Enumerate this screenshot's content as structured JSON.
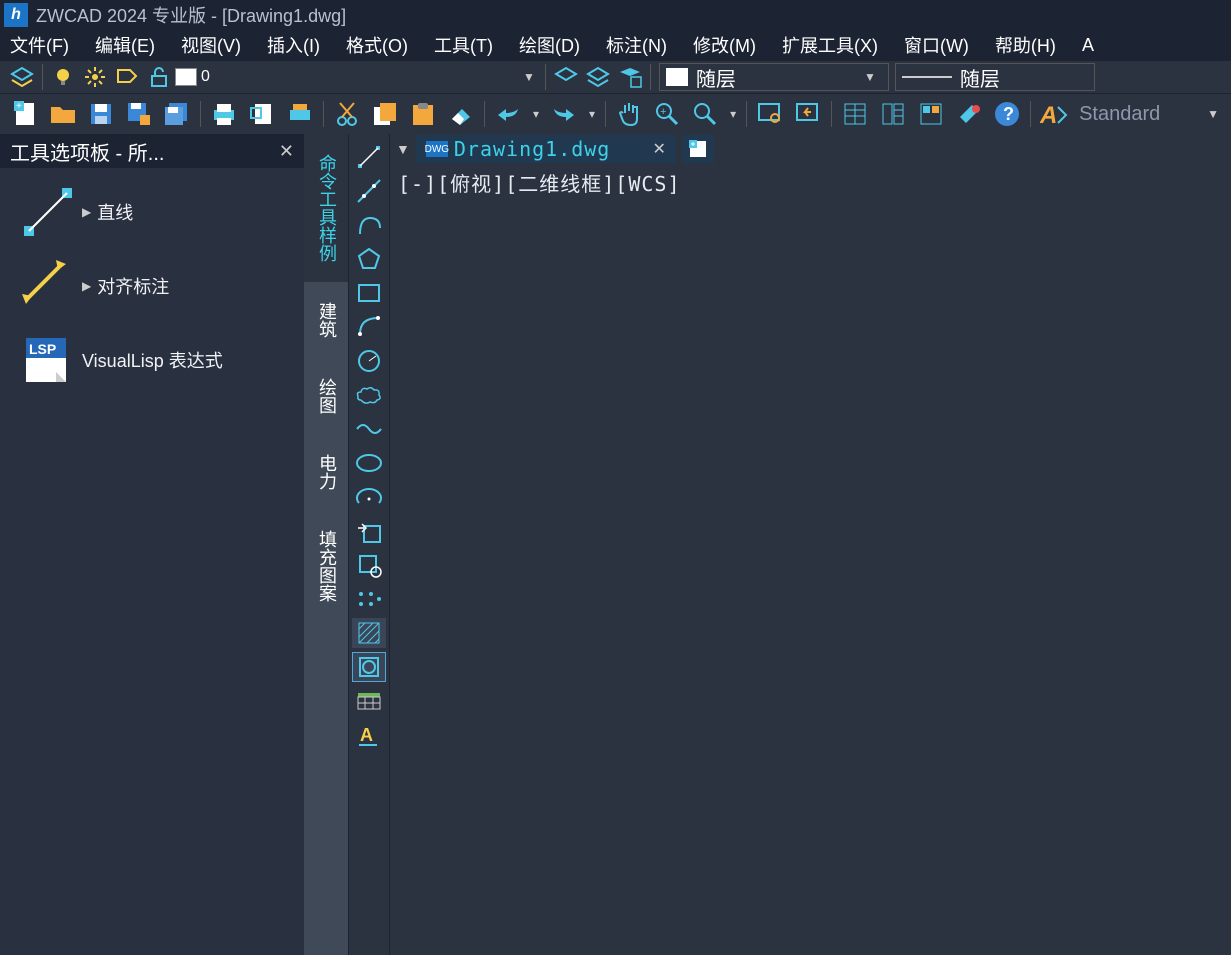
{
  "titlebar": {
    "title": "ZWCAD 2024 专业版 - [Drawing1.dwg]"
  },
  "menus": [
    "文件(F)",
    "编辑(E)",
    "视图(V)",
    "插入(I)",
    "格式(O)",
    "工具(T)",
    "绘图(D)",
    "标注(N)",
    "修改(M)",
    "扩展工具(X)",
    "窗口(W)",
    "帮助(H)",
    "A"
  ],
  "layer_row": {
    "current_layer": "0",
    "color_prop": "随层",
    "linetype": "随层"
  },
  "style_row": {
    "style_name": "Standard"
  },
  "palette": {
    "title": "工具选项板 - 所...",
    "items": [
      {
        "label": "直线"
      },
      {
        "label": "对齐标注"
      },
      {
        "label": "VisualLisp 表达式"
      }
    ]
  },
  "side_tabs": [
    "命令工具样例",
    "建筑",
    "绘图",
    "电力",
    "填充图案"
  ],
  "doc_tab": {
    "filename": "Drawing1.dwg"
  },
  "viewport": {
    "labels": "[-][俯视][二维线框][WCS]"
  }
}
